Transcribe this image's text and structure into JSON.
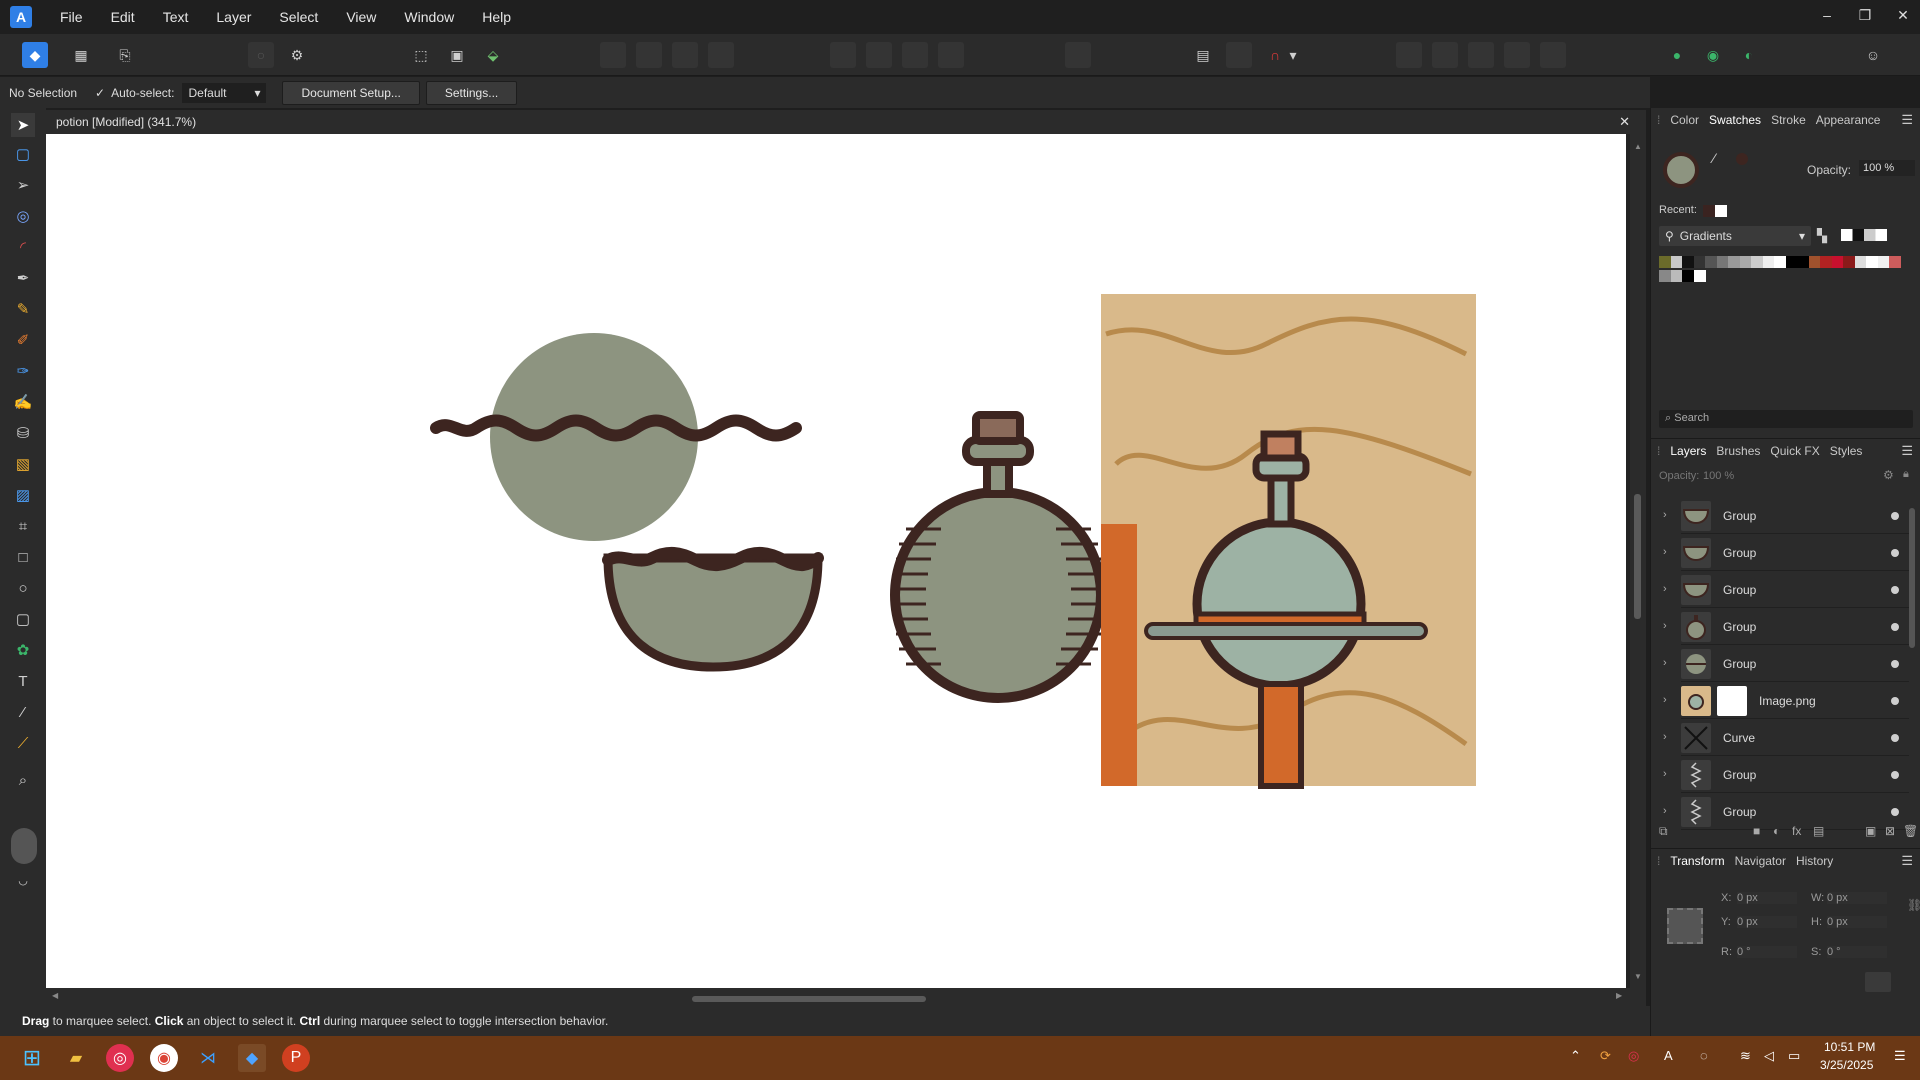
{
  "menu": {
    "logo": "A",
    "items": [
      "File",
      "Edit",
      "Text",
      "Layer",
      "Select",
      "View",
      "Window",
      "Help"
    ],
    "window_controls": [
      "–",
      "❐",
      "✕"
    ]
  },
  "context_bar": {
    "selection": "No Selection",
    "autoselect_label": "Auto-select:",
    "autoselect_value": "Default",
    "document_setup": "Document Setup...",
    "settings": "Settings..."
  },
  "document": {
    "tab_title": "potion [Modified] (341.7%)",
    "close": "✕"
  },
  "status": {
    "w1": "Drag",
    "t1": " to marquee select. ",
    "w2": "Click",
    "t2": " an object to select it. ",
    "w3": "Ctrl",
    "t3": " during marquee select to toggle intersection behavior."
  },
  "color_panel": {
    "tabs": [
      "Color",
      "Swatches",
      "Stroke",
      "Appearance"
    ],
    "active_tab": "Swatches",
    "opacity_label": "Opacity:",
    "opacity_value": "100 %",
    "recent_label": "Recent:",
    "palette_name": "Gradients",
    "search_placeholder": "Search",
    "recent_colors": [
      "#3a2320",
      "#ffffff"
    ],
    "swatches_row1": [
      "#6b6b2a",
      "#c8c8c8",
      "#111111",
      "#333333",
      "#555555",
      "#777777",
      "#999999",
      "#aaaaaa",
      "#cccccc",
      "#eeeeee",
      "#ffffff",
      "#000000",
      "#000000",
      "#a0522d",
      "#b22222",
      "#c8102e",
      "#8b1a1a",
      "#dddddd",
      "#ffffff",
      "#f0f0f0",
      "#cd5c5c"
    ],
    "swatches_row2": [
      "#888888",
      "#bbbbbb",
      "#000000",
      "#ffffff"
    ]
  },
  "layers_panel": {
    "tabs": [
      "Layers",
      "Brushes",
      "Quick FX",
      "Styles"
    ],
    "active_tab": "Layers",
    "opacity_label": "Opacity:",
    "opacity_value": "100 %",
    "layers": [
      {
        "name": "Group",
        "thumb": "bowl"
      },
      {
        "name": "Group",
        "thumb": "bowl"
      },
      {
        "name": "Group",
        "thumb": "bowl"
      },
      {
        "name": "Group",
        "thumb": "bottle"
      },
      {
        "name": "Group",
        "thumb": "circle"
      },
      {
        "name": "Image.png",
        "thumb": "image"
      },
      {
        "name": "Curve",
        "thumb": "curve"
      },
      {
        "name": "Group",
        "thumb": "squiggle"
      },
      {
        "name": "Group",
        "thumb": "squiggle"
      }
    ]
  },
  "transform_panel": {
    "tabs": [
      "Transform",
      "Navigator",
      "History"
    ],
    "active_tab": "Transform",
    "x_label": "X:",
    "x": "0 px",
    "y_label": "Y:",
    "y": "0 px",
    "w_label": "W:",
    "w": "0 px",
    "h_label": "H:",
    "h": "0 px",
    "r_label": "R:",
    "r": "0 °",
    "s_label": "S:",
    "s": "0 °"
  },
  "taskbar": {
    "time": "10:51 PM",
    "date": "3/25/2025",
    "tray_icons": [
      "chevron-up-icon",
      "sync-icon",
      "app-icon",
      "font-icon",
      "headset-icon",
      "wifi-icon",
      "speaker-icon",
      "battery-icon"
    ]
  },
  "colors": {
    "ink": "#3d2520",
    "potion_green": "#8d9480",
    "menu_bg": "#1f1f1f",
    "accent": "#2f7fe6",
    "taskbar": "#6b3815"
  }
}
